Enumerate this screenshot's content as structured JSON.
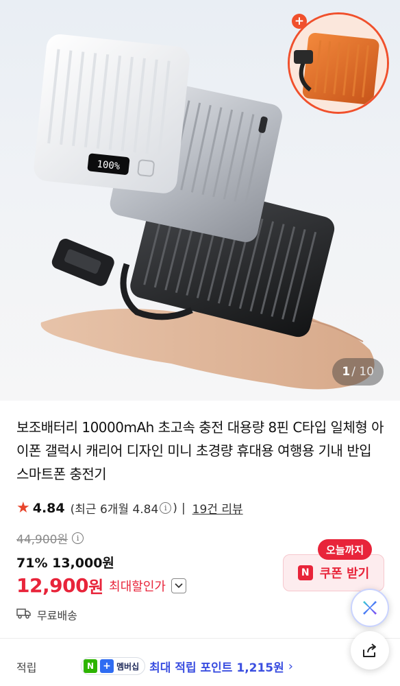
{
  "hero": {
    "counter_current": "1",
    "counter_total": "/ 10",
    "plus_badge": "+",
    "device_display": "100%"
  },
  "product": {
    "title": "보조배터리 10000mAh 초고속 충전 대용량 8핀 C타입 일체형 아이폰 갤럭시 캐리어 디자인 미니 초경량 휴대용 여행용 기내 반입 스마트폰 충전기",
    "rating_icon": "star-icon",
    "rating": "4.84",
    "recent_rating": "(최근 6개월 4.84",
    "recent_close": ")",
    "separator": "|",
    "review_count": "19건 리뷰"
  },
  "price": {
    "original": "44,900원",
    "discount": "71% 13,000원",
    "final_amount": "12,900",
    "final_unit": "원",
    "max_discount_label": "최대할인가"
  },
  "coupon": {
    "tag": "오늘까지",
    "icon_text": "N",
    "label": "쿠폰 받기"
  },
  "shipping": {
    "icon": "truck-icon",
    "label": "무료배송"
  },
  "points": {
    "label": "적립",
    "n_badge": "N",
    "plus_badge": "+",
    "membership": "멤버십",
    "text": "최대 적립 포인트 1,215원",
    "arrow": "›"
  },
  "colors": {
    "accent_red": "#e8243a",
    "star": "#e8452c",
    "point_blue": "#3a4ee0",
    "naver_green": "#2db400"
  }
}
